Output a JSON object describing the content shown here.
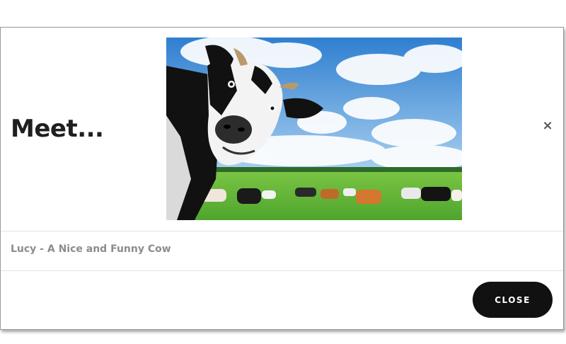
{
  "modal": {
    "title": "Meet...",
    "close_icon_glyph": "×",
    "image": {
      "subject": "black-and-white cow close-up with grazing herd in green meadow under blue cloudy sky",
      "colors": {
        "sky": "#3f8fd8",
        "grass": "#5fb83a",
        "cow_black": "#111111",
        "cow_white": "#f2f2f2"
      }
    },
    "caption": "Lucy - A Nice and Funny Cow",
    "close_button_label": "CLOSE"
  }
}
